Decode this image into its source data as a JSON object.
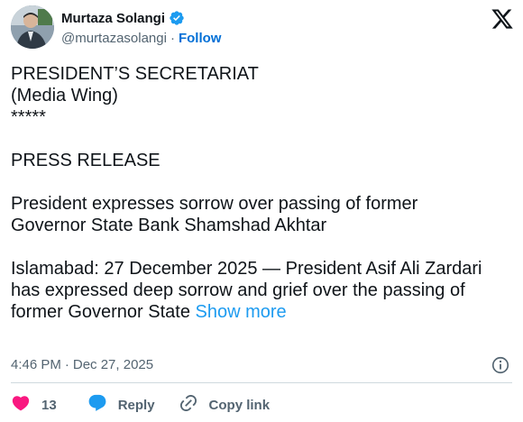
{
  "author": {
    "name": "Murtaza Solangi",
    "handle": "@murtazasolangi",
    "separator": "·",
    "follow_label": "Follow"
  },
  "post": {
    "line1": "PRESIDENT’S SECRETARIAT",
    "line2": "(Media Wing)",
    "line3": "*****",
    "press": "PRESS RELEASE",
    "headline": "President expresses sorrow over passing of former\nGovernor State Bank Shamshad Akhtar",
    "body": "Islamabad: 27 December 2025 — President Asif Ali Zardari\nhas expressed deep sorrow and grief over the passing of\nformer Governor State ",
    "show_more": "Show more"
  },
  "meta": {
    "time": "4:46 PM",
    "separator": "·",
    "date": "Dec 27, 2025"
  },
  "actions": {
    "like_count": "13",
    "reply_label": "Reply",
    "copy_label": "Copy link"
  },
  "colors": {
    "accent": "#1d9bf0",
    "follow": "#006fd6",
    "like": "#f91880",
    "muted": "#536471"
  }
}
